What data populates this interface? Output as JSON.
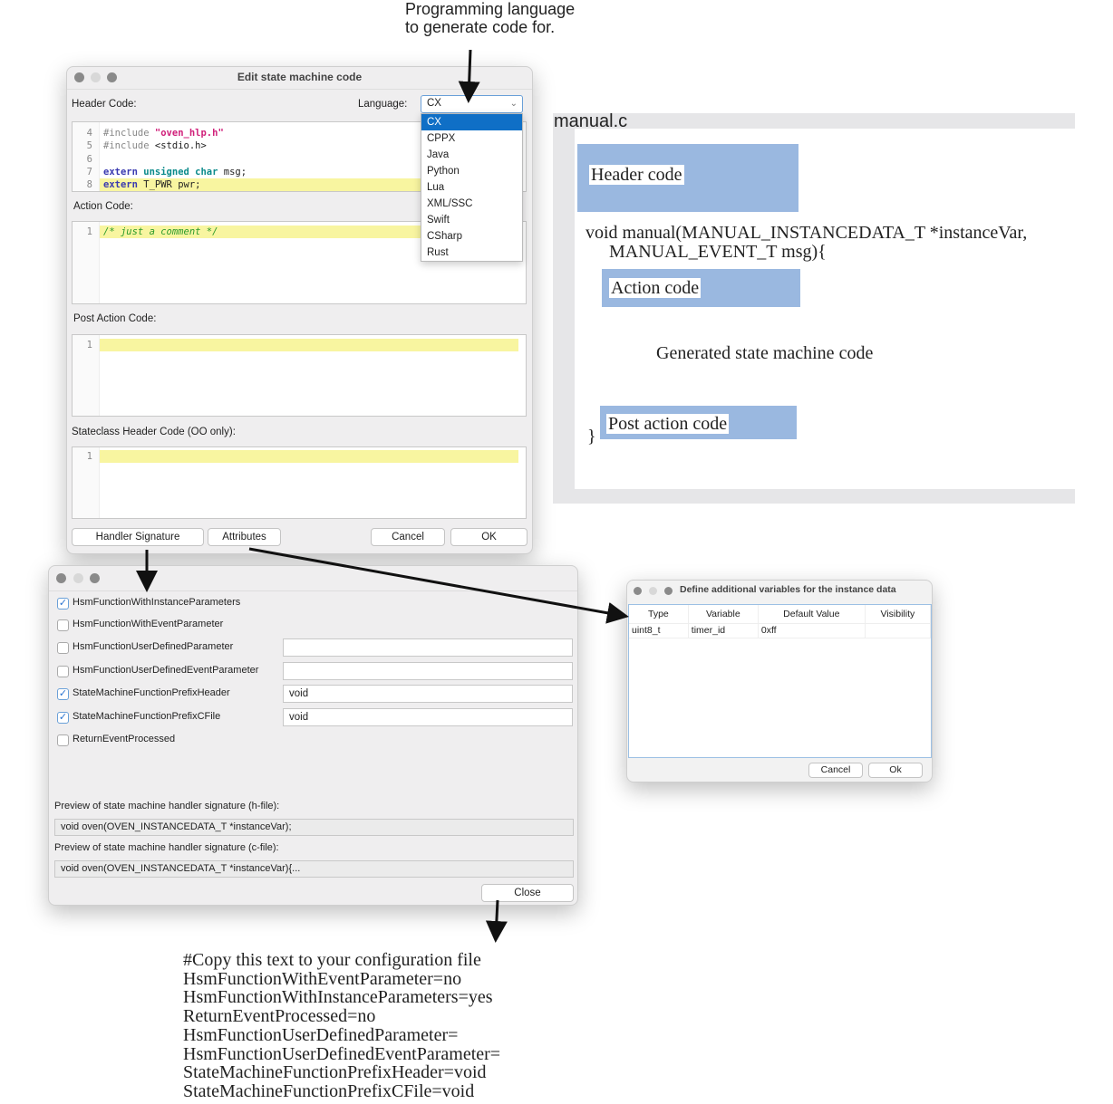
{
  "annotations": {
    "language_note": [
      "Programming language",
      "to generate code for."
    ],
    "config_note": [
      "#Copy this text to your configuration file",
      "HsmFunctionWithEventParameter=no",
      "HsmFunctionWithInstanceParameters=yes",
      "ReturnEventProcessed=no",
      "HsmFunctionUserDefinedParameter=",
      "HsmFunctionUserDefinedEventParameter=",
      "StateMachineFunctionPrefixHeader=void",
      "StateMachineFunctionPrefixCFile=void"
    ]
  },
  "edit_dialog": {
    "title": "Edit state machine code",
    "header_code_label": "Header Code:",
    "language_label": "Language:",
    "language_value": "CX",
    "language_options": [
      "CX",
      "CPPX",
      "Java",
      "Python",
      "Lua",
      "XML/SSC",
      "Swift",
      "CSharp",
      "Rust"
    ],
    "header_code_lines": [
      {
        "n": "4",
        "parts": [
          [
            "#include ",
            "#888"
          ],
          [
            "\"oven_hlp.h\"",
            "#d0207a"
          ]
        ]
      },
      {
        "n": "5",
        "parts": [
          [
            "#include ",
            "#888"
          ],
          [
            "<stdio.h>",
            "#222"
          ]
        ]
      },
      {
        "n": "6",
        "parts": []
      },
      {
        "n": "7",
        "parts": [
          [
            "extern ",
            "#3a3ab0"
          ],
          [
            "unsigned char ",
            "#0a8a8a"
          ],
          [
            "msg;",
            "#222"
          ]
        ]
      },
      {
        "n": "8",
        "parts": [
          [
            "extern ",
            "#3a3ab0"
          ],
          [
            "T_PWR pwr;",
            "#222"
          ]
        ],
        "highlight": true
      }
    ],
    "action_code_label": "Action Code:",
    "action_code_lines": [
      {
        "n": "1",
        "text": "/* just a comment */"
      }
    ],
    "post_action_code_label": "Post Action Code:",
    "post_action_code_lines": [
      {
        "n": "1",
        "text": ""
      }
    ],
    "stateclass_header_label": "Stateclass Header Code (OO only):",
    "stateclass_header_lines": [
      {
        "n": "1",
        "text": ""
      }
    ],
    "buttons": {
      "handler_signature": "Handler Signature",
      "attributes": "Attributes",
      "cancel": "Cancel",
      "ok": "OK"
    }
  },
  "code_diagram": {
    "file_name": "manual.c",
    "header_code": "Header code",
    "signature_line1": "void  manual(MANUAL_INSTANCEDATA_T *instanceVar,",
    "signature_line2": "MANUAL_EVENT_T  msg){",
    "action_code": "Action code",
    "generated": "Generated state machine code",
    "post_action_code": "Post action code",
    "closing_brace": "}",
    "box_color": "#9ab8e0"
  },
  "signature_dialog": {
    "options": [
      {
        "label": "HsmFunctionWithInstanceParameters",
        "checked": true
      },
      {
        "label": "HsmFunctionWithEventParameter",
        "checked": false
      },
      {
        "label": "HsmFunctionUserDefinedParameter",
        "checked": false,
        "value": ""
      },
      {
        "label": "HsmFunctionUserDefinedEventParameter",
        "checked": false,
        "value": ""
      },
      {
        "label": "StateMachineFunctionPrefixHeader",
        "checked": true,
        "value": "void"
      },
      {
        "label": "StateMachineFunctionPrefixCFile",
        "checked": true,
        "value": "void"
      },
      {
        "label": "ReturnEventProcessed",
        "checked": false
      }
    ],
    "preview_h_label": "Preview of state machine handler signature (h-file):",
    "preview_h": "void   oven(OVEN_INSTANCEDATA_T *instanceVar);",
    "preview_c_label": "Preview of state machine handler signature (c-file):",
    "preview_c": "void   oven(OVEN_INSTANCEDATA_T *instanceVar){...",
    "close": "Close"
  },
  "variables_dialog": {
    "title": "Define additional variables for the instance data",
    "columns": [
      "Type",
      "Variable",
      "Default Value",
      "Visibility"
    ],
    "rows": [
      [
        "uint8_t",
        "timer_id",
        "0xff",
        ""
      ]
    ],
    "cancel": "Cancel",
    "ok": "Ok"
  }
}
